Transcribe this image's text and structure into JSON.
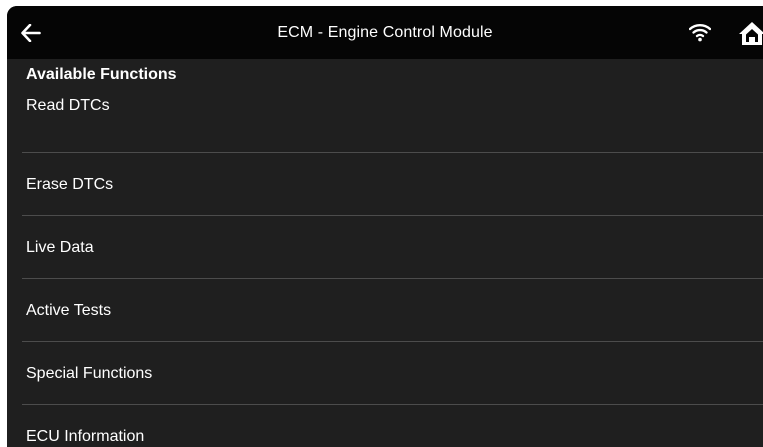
{
  "header": {
    "title": "ECM - Engine Control Module",
    "back_icon": "arrow-left-icon",
    "wifi_icon": "wifi-icon",
    "home_icon": "home-icon"
  },
  "section": {
    "title": "Available Functions"
  },
  "functions": [
    {
      "label": "Read DTCs"
    },
    {
      "label": "Erase DTCs"
    },
    {
      "label": "Live Data"
    },
    {
      "label": "Active Tests"
    },
    {
      "label": "Special Functions"
    },
    {
      "label": "ECU Information"
    }
  ],
  "colors": {
    "background": "#1f1f1f",
    "topbar": "#050505",
    "text": "#ffffff",
    "divider": "#4c4c4c"
  }
}
